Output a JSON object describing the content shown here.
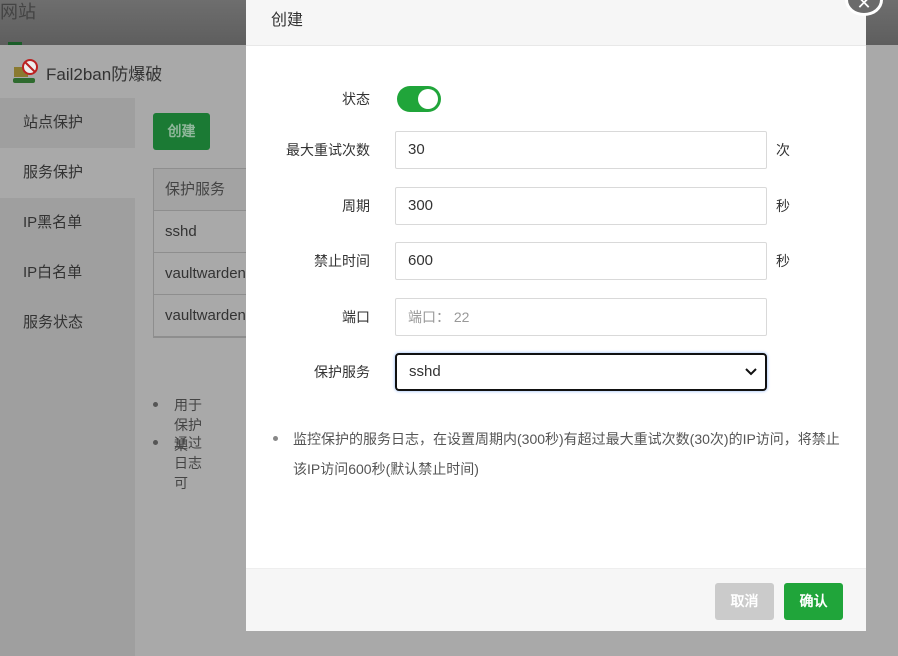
{
  "background": {
    "site_label": "网站",
    "panel_title": "Fail2ban防爆破",
    "sidebar": [
      "站点保护",
      "服务保护",
      "IP黑名单",
      "IP白名单",
      "服务状态"
    ],
    "create_button": "创建",
    "table": {
      "header": "保护服务",
      "rows": [
        "sshd",
        "vaultwarden",
        "vaultwarden"
      ]
    },
    "notes": [
      "用于保护某",
      "通过日志可"
    ]
  },
  "modal": {
    "title": "创建",
    "fields": {
      "status_label": "状态",
      "status_on": true,
      "max_retry_label": "最大重试次数",
      "max_retry": "30",
      "max_retry_unit": "次",
      "period_label": "周期",
      "period": "300",
      "period_unit": "秒",
      "ban_label": "禁止时间",
      "ban": "600",
      "ban_unit": "秒",
      "port_label": "端口",
      "port_placeholder": "端口： 22",
      "service_label": "保护服务",
      "service": "sshd"
    },
    "tip": "监控保护的服务日志，在设置周期内(300秒)有超过最大重试次数(30次)的IP访问，将禁止该IP访问600秒(默认禁止时间)",
    "cancel": "取消",
    "confirm": "确认"
  },
  "colors": {
    "accent": "#20a53a"
  }
}
